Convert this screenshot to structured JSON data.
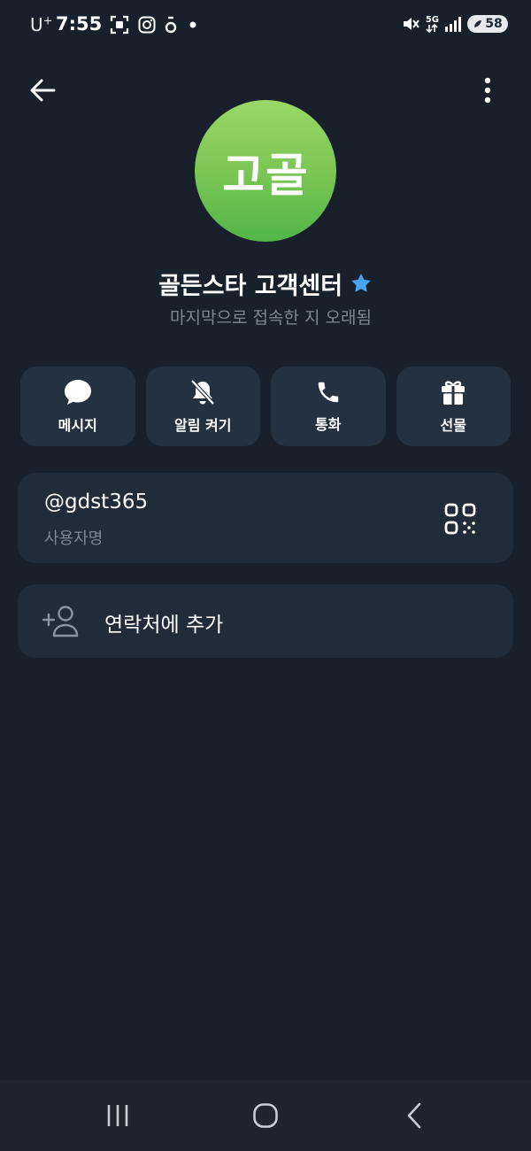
{
  "status_bar": {
    "carrier": "U",
    "carrier_plus": "+",
    "time": "7:55",
    "network": "5G",
    "battery": "58",
    "icons_left": [
      "screenshot-icon",
      "instagram-icon",
      "app-icon",
      "dot-icon"
    ],
    "icons_right": [
      "mute-icon",
      "network-5g-icon",
      "signal-icon",
      "battery-icon"
    ]
  },
  "header": {
    "back_icon": "back-arrow-icon",
    "menu_icon": "more-vertical-icon"
  },
  "profile": {
    "avatar_text": "고골",
    "avatar_color": "#6cc04f",
    "name": "골든스타 고객센터",
    "badge_icon": "star-badge-icon",
    "badge_color": "#4aa3f0",
    "last_seen": "마지막으로 접속한 지 오래됨"
  },
  "actions": [
    {
      "label": "메시지",
      "icon": "chat-bubble-icon"
    },
    {
      "label": "알림 켜기",
      "icon": "bell-off-icon"
    },
    {
      "label": "통화",
      "icon": "phone-icon"
    },
    {
      "label": "선물",
      "icon": "gift-icon"
    }
  ],
  "username": {
    "value": "@gdst365",
    "caption": "사용자명",
    "qr_icon": "qr-code-icon"
  },
  "add_contact": {
    "label": "연락처에 추가",
    "icon": "add-person-icon"
  },
  "nav_bar": {
    "icons": [
      "recent-apps-icon",
      "home-icon",
      "back-icon"
    ]
  },
  "colors": {
    "background": "#17202b",
    "card": "#212c3a",
    "button": "#243140",
    "secondary_text": "#7e8893"
  }
}
